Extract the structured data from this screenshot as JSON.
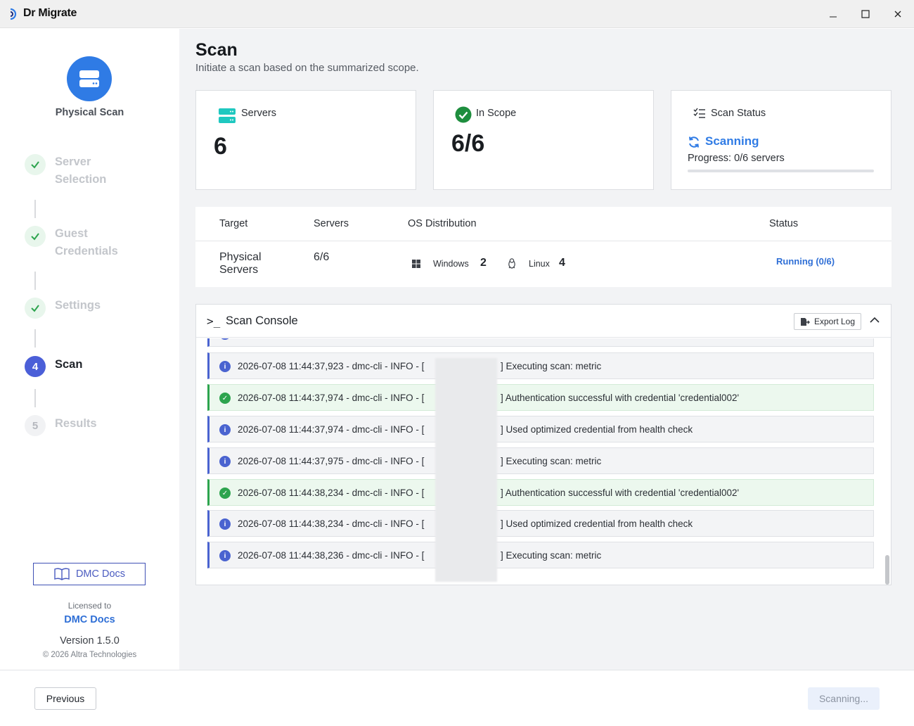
{
  "window": {
    "app_title": "Dr Migrate",
    "minimize_glyph": "—",
    "maximize_glyph": "☐",
    "close_glyph": "✕"
  },
  "sidebar": {
    "hero_label": "Physical Scan",
    "hero_icon": "server-icon",
    "steps": [
      {
        "label": "Server\nSelection",
        "state": "done",
        "marker": "✓"
      },
      {
        "label": "Guest\nCredentials",
        "state": "done",
        "marker": "✓"
      },
      {
        "label": "Settings",
        "state": "done",
        "marker": "✓"
      },
      {
        "label": "Scan",
        "state": "active",
        "marker": "4"
      },
      {
        "label": "Results",
        "state": "pending",
        "marker": "5"
      }
    ],
    "docs_button": "DMC Docs",
    "licensed_to_label": "Licensed to",
    "licensee": "DMC Docs",
    "version": "Version 1.5.0",
    "copyright": "© 2026 Altra Technologies"
  },
  "page": {
    "title": "Scan",
    "subtitle": "Initiate a scan based on the summarized scope."
  },
  "cards": {
    "servers": {
      "title": "Servers",
      "value": "6"
    },
    "in_scope": {
      "title": "In Scope",
      "value": "6/6"
    },
    "scan_status": {
      "title": "Scan Status",
      "state": "Scanning",
      "progress_text": "Progress: 0/6 servers",
      "progress_fraction": 0
    }
  },
  "scope_table": {
    "headers": {
      "target": "Target",
      "servers": "Servers",
      "os": "OS Distribution",
      "status": "Status"
    },
    "row": {
      "target": "Physical\nServers",
      "servers": "6/6",
      "windows_label": "Windows",
      "windows_count": "2",
      "linux_label": "Linux",
      "linux_count": "4",
      "status": "Running (0/6)"
    }
  },
  "console": {
    "title": "Scan Console",
    "prompt_glyph": ">_",
    "export_label": "Export Log",
    "logs": [
      {
        "level": "info",
        "prefix": "2026-07-08 11:44:37,923 - dmc-cli - INFO - [",
        "message": "] Executing scan: metric"
      },
      {
        "level": "success",
        "prefix": "2026-07-08 11:44:37,974 - dmc-cli - INFO - [",
        "message": "] Authentication successful with credential 'credential002'"
      },
      {
        "level": "info",
        "prefix": "2026-07-08 11:44:37,974 - dmc-cli - INFO - [",
        "message": "] Used optimized credential from health check"
      },
      {
        "level": "info",
        "prefix": "2026-07-08 11:44:37,975 - dmc-cli - INFO - [",
        "message": "] Executing scan: metric"
      },
      {
        "level": "success",
        "prefix": "2026-07-08 11:44:38,234 - dmc-cli - INFO - [",
        "message": "] Authentication successful with credential 'credential002'"
      },
      {
        "level": "info",
        "prefix": "2026-07-08 11:44:38,234 - dmc-cli - INFO - [",
        "message": "] Used optimized credential from health check"
      },
      {
        "level": "info",
        "prefix": "2026-07-08 11:44:38,236 - dmc-cli - INFO - [",
        "message": "] Executing scan: metric"
      }
    ]
  },
  "footer": {
    "previous": "Previous",
    "scanning": "Scanning..."
  },
  "colors": {
    "accent": "#2f7be5",
    "step_active": "#4b5fd8",
    "success": "#2da44e",
    "info": "#4a63d0",
    "server_teal": "#1fc8c0"
  }
}
